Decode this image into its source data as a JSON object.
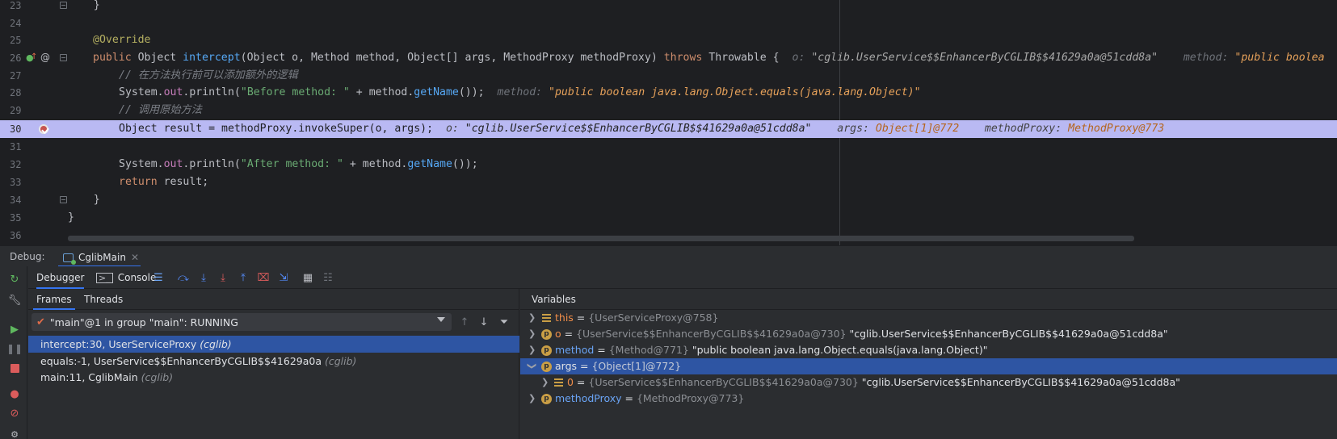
{
  "editor": {
    "lines": [
      {
        "no": "23"
      },
      {
        "no": "24"
      },
      {
        "no": "25"
      },
      {
        "no": "26"
      },
      {
        "no": "27"
      },
      {
        "no": "28"
      },
      {
        "no": "29"
      },
      {
        "no": "30"
      },
      {
        "no": "31"
      },
      {
        "no": "32"
      },
      {
        "no": "33"
      },
      {
        "no": "34"
      },
      {
        "no": "35"
      },
      {
        "no": "36"
      }
    ],
    "code": {
      "l23_brace": "    }",
      "l25_annotation": "@Override",
      "l26_public": "public",
      "l26_sig_a": " Object ",
      "l26_method": "intercept",
      "l26_sig_b": "(Object o, Method ",
      "l26_method_param": "method",
      "l26_sig_c": ", Object[] ",
      "l26_args": "args",
      "l26_sig_d": ", MethodProxy ",
      "l26_proxy": "methodProxy",
      "l26_sig_e": ") ",
      "l26_throws": "throws",
      "l26_sig_f": " Throwable {",
      "l26_inline_o_key": "o: ",
      "l26_inline_o_val": "\"cglib.UserService$$EnhancerByCGLIB$$41629a0a@51cdd8a\"",
      "l26_inline_m_key": "method: ",
      "l26_inline_m_val": "\"public boolea",
      "l27_comment": "// 在方法执行前可以添加额外的逻辑",
      "l28_system": "System.",
      "l28_out": "out",
      "l28_println": ".println(",
      "l28_str": "\"Before method: \"",
      "l28_plus": " + ",
      "l28_method": "method",
      "l28_get": ".",
      "l28_getname": "getName",
      "l28_end": "());",
      "l28_inline_key": "method: ",
      "l28_inline_val": "\"public boolean java.lang.Object.equals(java.lang.Object)\"",
      "l29_comment": "// 调用原始方法",
      "l30_code": "Object result = methodProxy.invokeSuper(o, args);",
      "l30_inline_o_key": "o: ",
      "l30_inline_o_val": "\"cglib.UserService$$EnhancerByCGLIB$$41629a0a@51cdd8a\"",
      "l30_inline_args_key": "args: ",
      "l30_inline_args_val": "Object[1]@772",
      "l30_inline_proxy_key": "methodProxy: ",
      "l30_inline_proxy_val": "MethodProxy@773",
      "l32_system": "System.",
      "l32_out": "out",
      "l32_println": ".println(",
      "l32_str": "\"After method: \"",
      "l32_plus": " + ",
      "l32_method": "method",
      "l32_get": ".",
      "l32_getname": "getName",
      "l32_end": "());",
      "l33_return": "return",
      "l33_rest": " result;",
      "l34_brace": "    }",
      "l35_brace": "}"
    }
  },
  "debug": {
    "label": "Debug:",
    "session_tab": "CglibMain",
    "tabs": {
      "debugger": "Debugger",
      "console": "Console"
    },
    "frames": {
      "tab_frames": "Frames",
      "tab_threads": "Threads",
      "thread": "\"main\"@1 in group \"main\": RUNNING",
      "items": [
        {
          "method": "intercept:30, UserServiceProxy ",
          "pkg": "(cglib)"
        },
        {
          "method": "equals:-1, UserService$$EnhancerByCGLIB$$41629a0a ",
          "pkg": "(cglib)"
        },
        {
          "method": "main:11, CglibMain ",
          "pkg": "(cglib)"
        }
      ]
    },
    "variables": {
      "title": "Variables",
      "items": [
        {
          "name": "this",
          "eq": " = ",
          "type": "{UserServiceProxy@758}",
          "value": ""
        },
        {
          "name": "o",
          "eq": " = ",
          "type": "{UserService$$EnhancerByCGLIB$$41629a0a@730}",
          "value": " \"cglib.UserService$$EnhancerByCGLIB$$41629a0a@51cdd8a\""
        },
        {
          "name": "method",
          "eq": " = ",
          "type": "{Method@771}",
          "value": " \"public boolean java.lang.Object.equals(java.lang.Object)\""
        },
        {
          "name": "args",
          "eq": " = ",
          "type": "{Object[1]@772}",
          "value": ""
        },
        {
          "name": "0",
          "eq": " = ",
          "type": "{UserService$$EnhancerByCGLIB$$41629a0a@730}",
          "value": " \"cglib.UserService$$EnhancerByCGLIB$$41629a0a@51cdd8a\""
        },
        {
          "name": "methodProxy",
          "eq": " = ",
          "type": "{MethodProxy@773}",
          "value": ""
        }
      ]
    }
  },
  "colors": {
    "editor_bg": "#1e1f22",
    "panel_bg": "#2b2d30",
    "current_line": "#b9b9f3",
    "selection": "#2e55a3",
    "keyword": "#cf8e6d",
    "annotation": "#b3ae60",
    "string": "#6aab73",
    "function": "#56a8f5",
    "inline_value": "#e6a15a"
  }
}
